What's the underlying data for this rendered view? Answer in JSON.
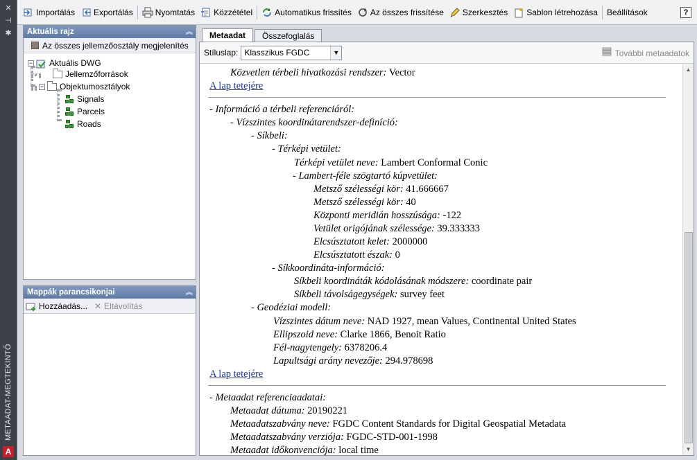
{
  "side_strip": {
    "title": "METAADAT-MEGTEKINTŐ",
    "logo": "A"
  },
  "toolbar": {
    "items": [
      {
        "label": "Importálás",
        "icon": "import-icon"
      },
      {
        "label": "Exportálás",
        "icon": "export-icon"
      },
      {
        "label": "Nyomtatás",
        "icon": "print-icon"
      },
      {
        "label": "Közzététel",
        "icon": "publish-icon"
      },
      {
        "label": "Automatikus frissítés",
        "icon": "auto-refresh-icon"
      },
      {
        "label": "Az összes frissítése",
        "icon": "refresh-all-icon"
      },
      {
        "label": "Szerkesztés",
        "icon": "edit-icon"
      },
      {
        "label": "Sablon létrehozása",
        "icon": "create-template-icon"
      },
      {
        "label": "Beállítások",
        "icon": ""
      }
    ],
    "help": "?"
  },
  "current_drawing_panel": {
    "title": "Aktuális rajz",
    "show_all": "Az  összes  jellemzőosztály  megjelenítés",
    "tree": {
      "root": "Aktuális DWG",
      "feature_sources": "Jellemzőforrások",
      "object_classes": "Objektumosztályok",
      "layers": [
        "Signals",
        "Parcels",
        "Roads"
      ]
    }
  },
  "folder_panel": {
    "title": "Mappák parancsikonjai",
    "add": "Hozzáadás...",
    "remove": "Eltávolítás"
  },
  "tabs": {
    "metadata": "Metaadat",
    "summary": "Összefoglalás"
  },
  "stylebar": {
    "label": "Stíluslap:",
    "value": "Klasszikus FGDC",
    "more": "További metaadatok"
  },
  "content": {
    "direct_ref": {
      "k": "Közvetlen térbeli hivatkozási rendszer:",
      "v": "Vector"
    },
    "top_link": "A lap tetejére",
    "spatial_ref": "- Információ a térbeli referenciáról:",
    "horiz_def": "- Vízszintes koordinátarendszer-definíció:",
    "planar": "- Síkbeli:",
    "map_proj": "- Térképi vetület:",
    "map_proj_name": {
      "k": "Térképi vetület neve:",
      "v": "Lambert Conformal Conic"
    },
    "lambert": "- Lambert-féle szögtartó kúpvetület:",
    "params": [
      {
        "k": "Metsző szélességi kör:",
        "v": "41.666667"
      },
      {
        "k": "Metsző szélességi kör:",
        "v": "40"
      },
      {
        "k": "Központi meridián hosszúsága:",
        "v": "-122"
      },
      {
        "k": "Vetület origójának szélessége:",
        "v": "39.333333"
      },
      {
        "k": "Elcsúsztatott kelet:",
        "v": "2000000"
      },
      {
        "k": "Elcsúsztatott észak:",
        "v": "0"
      }
    ],
    "planar_coord": "- Síkkoordináta-információ:",
    "encoding": {
      "k": "Síkbeli koordináták kódolásának módszere:",
      "v": "coordinate pair"
    },
    "distance": {
      "k": "Síkbeli távolságegységek:",
      "v": "survey feet"
    },
    "geodetic": "- Geodéziai modell:",
    "datum": {
      "k": "Vízszintes dátum neve:",
      "v": "NAD 1927, mean Values, Continental United States"
    },
    "ellipsoid": {
      "k": "Ellipszoid neve:",
      "v": "Clarke 1866, Benoit Ratio"
    },
    "semi_major": {
      "k": "Fél-nagytengely:",
      "v": "6378206.4"
    },
    "flattening": {
      "k": "Lapultsági arány nevezője:",
      "v": "294.978698"
    },
    "meta_ref": "- Metaadat referenciaadatai:",
    "meta_date": {
      "k": "Metaadat dátuma:",
      "v": "20190221"
    },
    "meta_std": {
      "k": "Metaadatszabvány neve:",
      "v": "FGDC Content Standards for Digital Geospatial Metadata"
    },
    "meta_ver": {
      "k": "Metaadatszabvány verziója:",
      "v": "FGDC-STD-001-1998"
    },
    "meta_time": {
      "k": "Metaadat időkonvenciója:",
      "v": "local time"
    }
  }
}
